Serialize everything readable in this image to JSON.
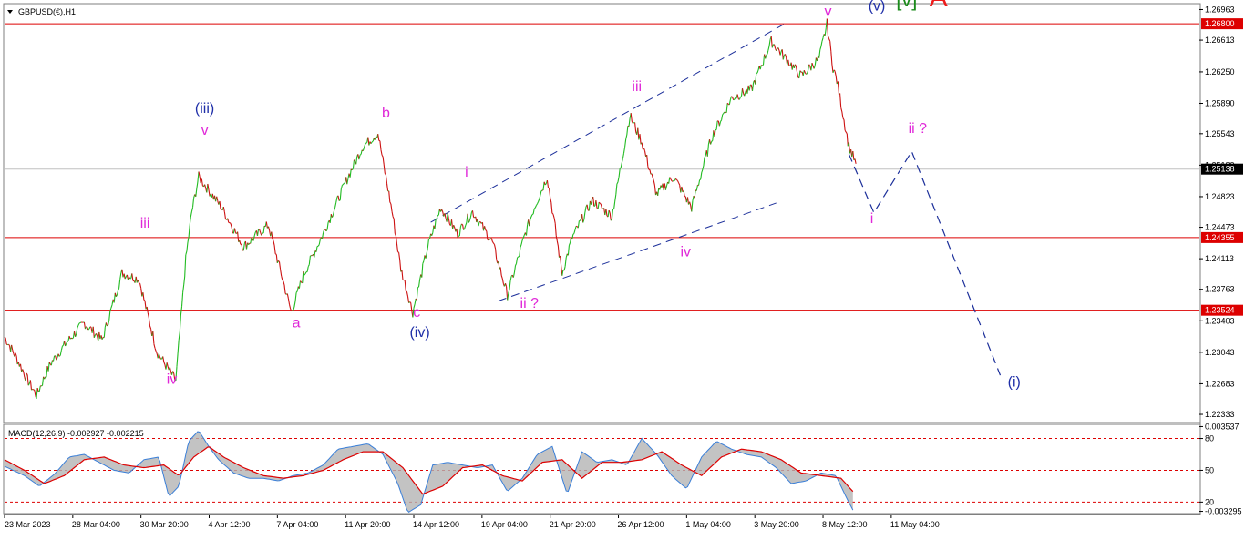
{
  "chart_data": [
    {
      "type": "line",
      "symbol_label": "GBPUSD(€),H1",
      "price_scale_ticks": [
        "1.26963",
        "1.26613",
        "1.26250",
        "1.25890",
        "1.25543",
        "1.25183",
        "1.24823",
        "1.24473",
        "1.24113",
        "1.23763",
        "1.23403",
        "1.23043",
        "1.22683",
        "1.22333"
      ],
      "ylim": [
        1.2225,
        1.2702
      ],
      "time_labels": [
        "23 Mar 2023",
        "28 Mar 04:00",
        "30 Mar 20:00",
        "4 Apr 12:00",
        "7 Apr 04:00",
        "11 Apr 20:00",
        "14 Apr 12:00",
        "19 Apr 04:00",
        "21 Apr 20:00",
        "26 Apr 12:00",
        "1 May 04:00",
        "3 May 20:00",
        "8 May 12:00",
        "11 May 04:00"
      ],
      "x_bars": [
        0,
        1200
      ],
      "price_series": {
        "name": "GBPUSD H1",
        "x": [
          0,
          12,
          22,
          32,
          46,
          62,
          80,
          98,
          118,
          135,
          153,
          172,
          182,
          188,
          195,
          218,
          240,
          265,
          288,
          300,
          320,
          345,
          360,
          375,
          390,
          398,
          410,
          425,
          438,
          455,
          470,
          490,
          505,
          523,
          532,
          545,
          560,
          570,
          590,
          610,
          628,
          640,
          655,
          672,
          690,
          710,
          730,
          750,
          770,
          785,
          800,
          818,
          826,
          832,
          836,
          843,
          848,
          855
        ],
        "y": [
          1.2322,
          1.2298,
          1.2275,
          1.2255,
          1.2291,
          1.2315,
          1.2338,
          1.2318,
          1.2395,
          1.2388,
          1.2305,
          1.2272,
          1.241,
          1.2465,
          1.2505,
          1.247,
          1.2425,
          1.245,
          1.235,
          1.2392,
          1.244,
          1.2505,
          1.254,
          1.2555,
          1.246,
          1.24,
          1.235,
          1.2425,
          1.247,
          1.244,
          1.2465,
          1.243,
          1.237,
          1.244,
          1.247,
          1.2505,
          1.2395,
          1.2435,
          1.2478,
          1.246,
          1.2575,
          1.2545,
          1.2485,
          1.2505,
          1.247,
          1.255,
          1.2595,
          1.2605,
          1.266,
          1.264,
          1.262,
          1.264,
          1.268,
          1.263,
          1.2615,
          1.257,
          1.254,
          1.252
        ]
      },
      "current_price": "1.25138",
      "level_lines": [
        {
          "price": 1.268,
          "label": "1.26800",
          "color": "#dd0000"
        },
        {
          "price": 1.24355,
          "label": "1.24355",
          "color": "#dd0000"
        },
        {
          "price": 1.23524,
          "label": "1.23524",
          "color": "#dd0000"
        }
      ],
      "bid_line_color": "#c0c0c0",
      "channel_lines": [
        {
          "x": [
            428,
            785
          ],
          "y": [
            1.2453,
            1.2681
          ],
          "color": "#1c2f9a"
        },
        {
          "x": [
            496,
            775
          ],
          "y": [
            1.2363,
            1.2475
          ],
          "color": "#1c2f9a"
        }
      ],
      "projection": {
        "x": [
          848,
          873,
          911,
          1000
        ],
        "y": [
          1.2531,
          1.2464,
          1.2534,
          1.2278
        ],
        "color": "#1c2f9a"
      },
      "wave_labels": [
        {
          "text": "(iii)",
          "x": 201,
          "y": 1.2578,
          "color": "#1f2fa8"
        },
        {
          "text": "v",
          "x": 201,
          "y": 1.2553,
          "color": "#e028d8"
        },
        {
          "text": "iii",
          "x": 141,
          "y": 1.2447,
          "color": "#e028d8"
        },
        {
          "text": "iv",
          "x": 168,
          "y": 1.2268,
          "color": "#e028d8"
        },
        {
          "text": "a",
          "x": 293,
          "y": 1.2333,
          "color": "#e028d8"
        },
        {
          "text": "b",
          "x": 383,
          "y": 1.2573,
          "color": "#e028d8"
        },
        {
          "text": "c",
          "x": 414,
          "y": 1.2345,
          "color": "#e028d8"
        },
        {
          "text": "(iv)",
          "x": 417,
          "y": 1.2322,
          "color": "#1f2fa8"
        },
        {
          "text": "i",
          "x": 464,
          "y": 1.2505,
          "color": "#e028d8"
        },
        {
          "text": "ii ?",
          "x": 527,
          "y": 1.2355,
          "color": "#e028d8"
        },
        {
          "text": "iii",
          "x": 635,
          "y": 1.2603,
          "color": "#e028d8"
        },
        {
          "text": "iv",
          "x": 684,
          "y": 1.2414,
          "color": "#e028d8"
        },
        {
          "text": "v",
          "x": 827,
          "y": 1.2689,
          "color": "#e028d8"
        },
        {
          "text": "(v)",
          "x": 876,
          "y": 1.2695,
          "color": "#1f2fa8"
        },
        {
          "text": "[v]",
          "x": 906,
          "y": 1.27,
          "color": "#1a8a1a"
        },
        {
          "text": "A",
          "x": 938,
          "y": 1.27,
          "color": "#ee1c1c"
        },
        {
          "text": "ii ?",
          "x": 917,
          "y": 1.2555,
          "color": "#e028d8"
        },
        {
          "text": "i",
          "x": 871,
          "y": 1.2452,
          "color": "#e028d8"
        },
        {
          "text": "(i)",
          "x": 1014,
          "y": 1.2265,
          "color": "#1f2fa8"
        }
      ]
    },
    {
      "type": "line",
      "indicator_label": "MACD(12,26,9) -0.002927 -0.002215",
      "ylim": [
        -0.0032,
        0.0034
      ],
      "scale_ticks": [
        {
          "label": "0.003537",
          "value": 0.0033
        },
        {
          "label": "80",
          "value": 0.0024
        },
        {
          "label": "50",
          "value": 0.0
        },
        {
          "label": "20",
          "value": -0.0024
        },
        {
          "label": "-0.003295",
          "value": -0.0031
        }
      ],
      "dotted_levels": [
        0.0024,
        0.0,
        -0.0024
      ],
      "dotted_color": "#dd0000",
      "macd": {
        "name": "MACD",
        "color": "#d3d3d3",
        "x": [
          0,
          20,
          35,
          50,
          65,
          80,
          95,
          110,
          125,
          140,
          155,
          165,
          175,
          185,
          195,
          205,
          215,
          230,
          245,
          260,
          275,
          290,
          305,
          320,
          335,
          350,
          365,
          380,
          395,
          405,
          418,
          430,
          445,
          460,
          475,
          490,
          505,
          520,
          535,
          550,
          565,
          580,
          595,
          610,
          625,
          640,
          655,
          670,
          685,
          700,
          715,
          730,
          745,
          760,
          775,
          790,
          805,
          820,
          835,
          845,
          852
        ],
        "y": [
          0.0003,
          -0.0004,
          -0.0012,
          -0.0003,
          0.001,
          0.0012,
          0.0006,
          0.0,
          -0.0002,
          0.0008,
          0.001,
          -0.002,
          -0.0012,
          0.0022,
          0.003,
          0.0018,
          0.0008,
          -0.0002,
          -0.0006,
          -0.0006,
          -0.0008,
          -0.0004,
          -0.0002,
          0.0004,
          0.0016,
          0.0018,
          0.002,
          0.0012,
          -0.001,
          -0.0032,
          -0.0026,
          0.0004,
          0.0006,
          0.0004,
          0.0002,
          0.0004,
          -0.0016,
          -0.0006,
          0.0012,
          0.0018,
          -0.0018,
          0.0014,
          0.0006,
          0.0008,
          0.0004,
          0.0024,
          0.0012,
          -0.0004,
          -0.0014,
          0.001,
          0.0022,
          0.0016,
          0.0012,
          0.001,
          0.0002,
          -0.001,
          -0.0008,
          -0.0002,
          -0.0004,
          -0.002,
          -0.003
        ]
      },
      "signal": {
        "name": "Signal",
        "color": "#dd0000",
        "x": [
          0,
          20,
          40,
          60,
          80,
          100,
          120,
          140,
          160,
          175,
          190,
          205,
          220,
          240,
          260,
          280,
          300,
          320,
          340,
          360,
          380,
          400,
          420,
          440,
          460,
          480,
          500,
          520,
          540,
          560,
          580,
          600,
          620,
          640,
          660,
          680,
          700,
          720,
          740,
          760,
          780,
          800,
          820,
          840,
          852
        ],
        "y": [
          0.0008,
          0.0,
          -0.001,
          -0.0004,
          0.0008,
          0.001,
          0.0004,
          0.0002,
          0.0004,
          -0.0004,
          0.001,
          0.0018,
          0.001,
          0.0002,
          -0.0004,
          -0.0006,
          -0.0004,
          0.0,
          0.0008,
          0.0014,
          0.0014,
          0.0002,
          -0.0018,
          -0.0012,
          0.0002,
          0.0004,
          -0.0004,
          -0.0008,
          0.0006,
          0.0008,
          -0.0006,
          0.0006,
          0.0006,
          0.0008,
          0.0014,
          0.0004,
          -0.0004,
          0.001,
          0.0016,
          0.0014,
          0.0008,
          -0.0002,
          -0.0004,
          -0.0006,
          -0.0016
        ]
      },
      "fill_color": "#b4b4b4"
    }
  ]
}
